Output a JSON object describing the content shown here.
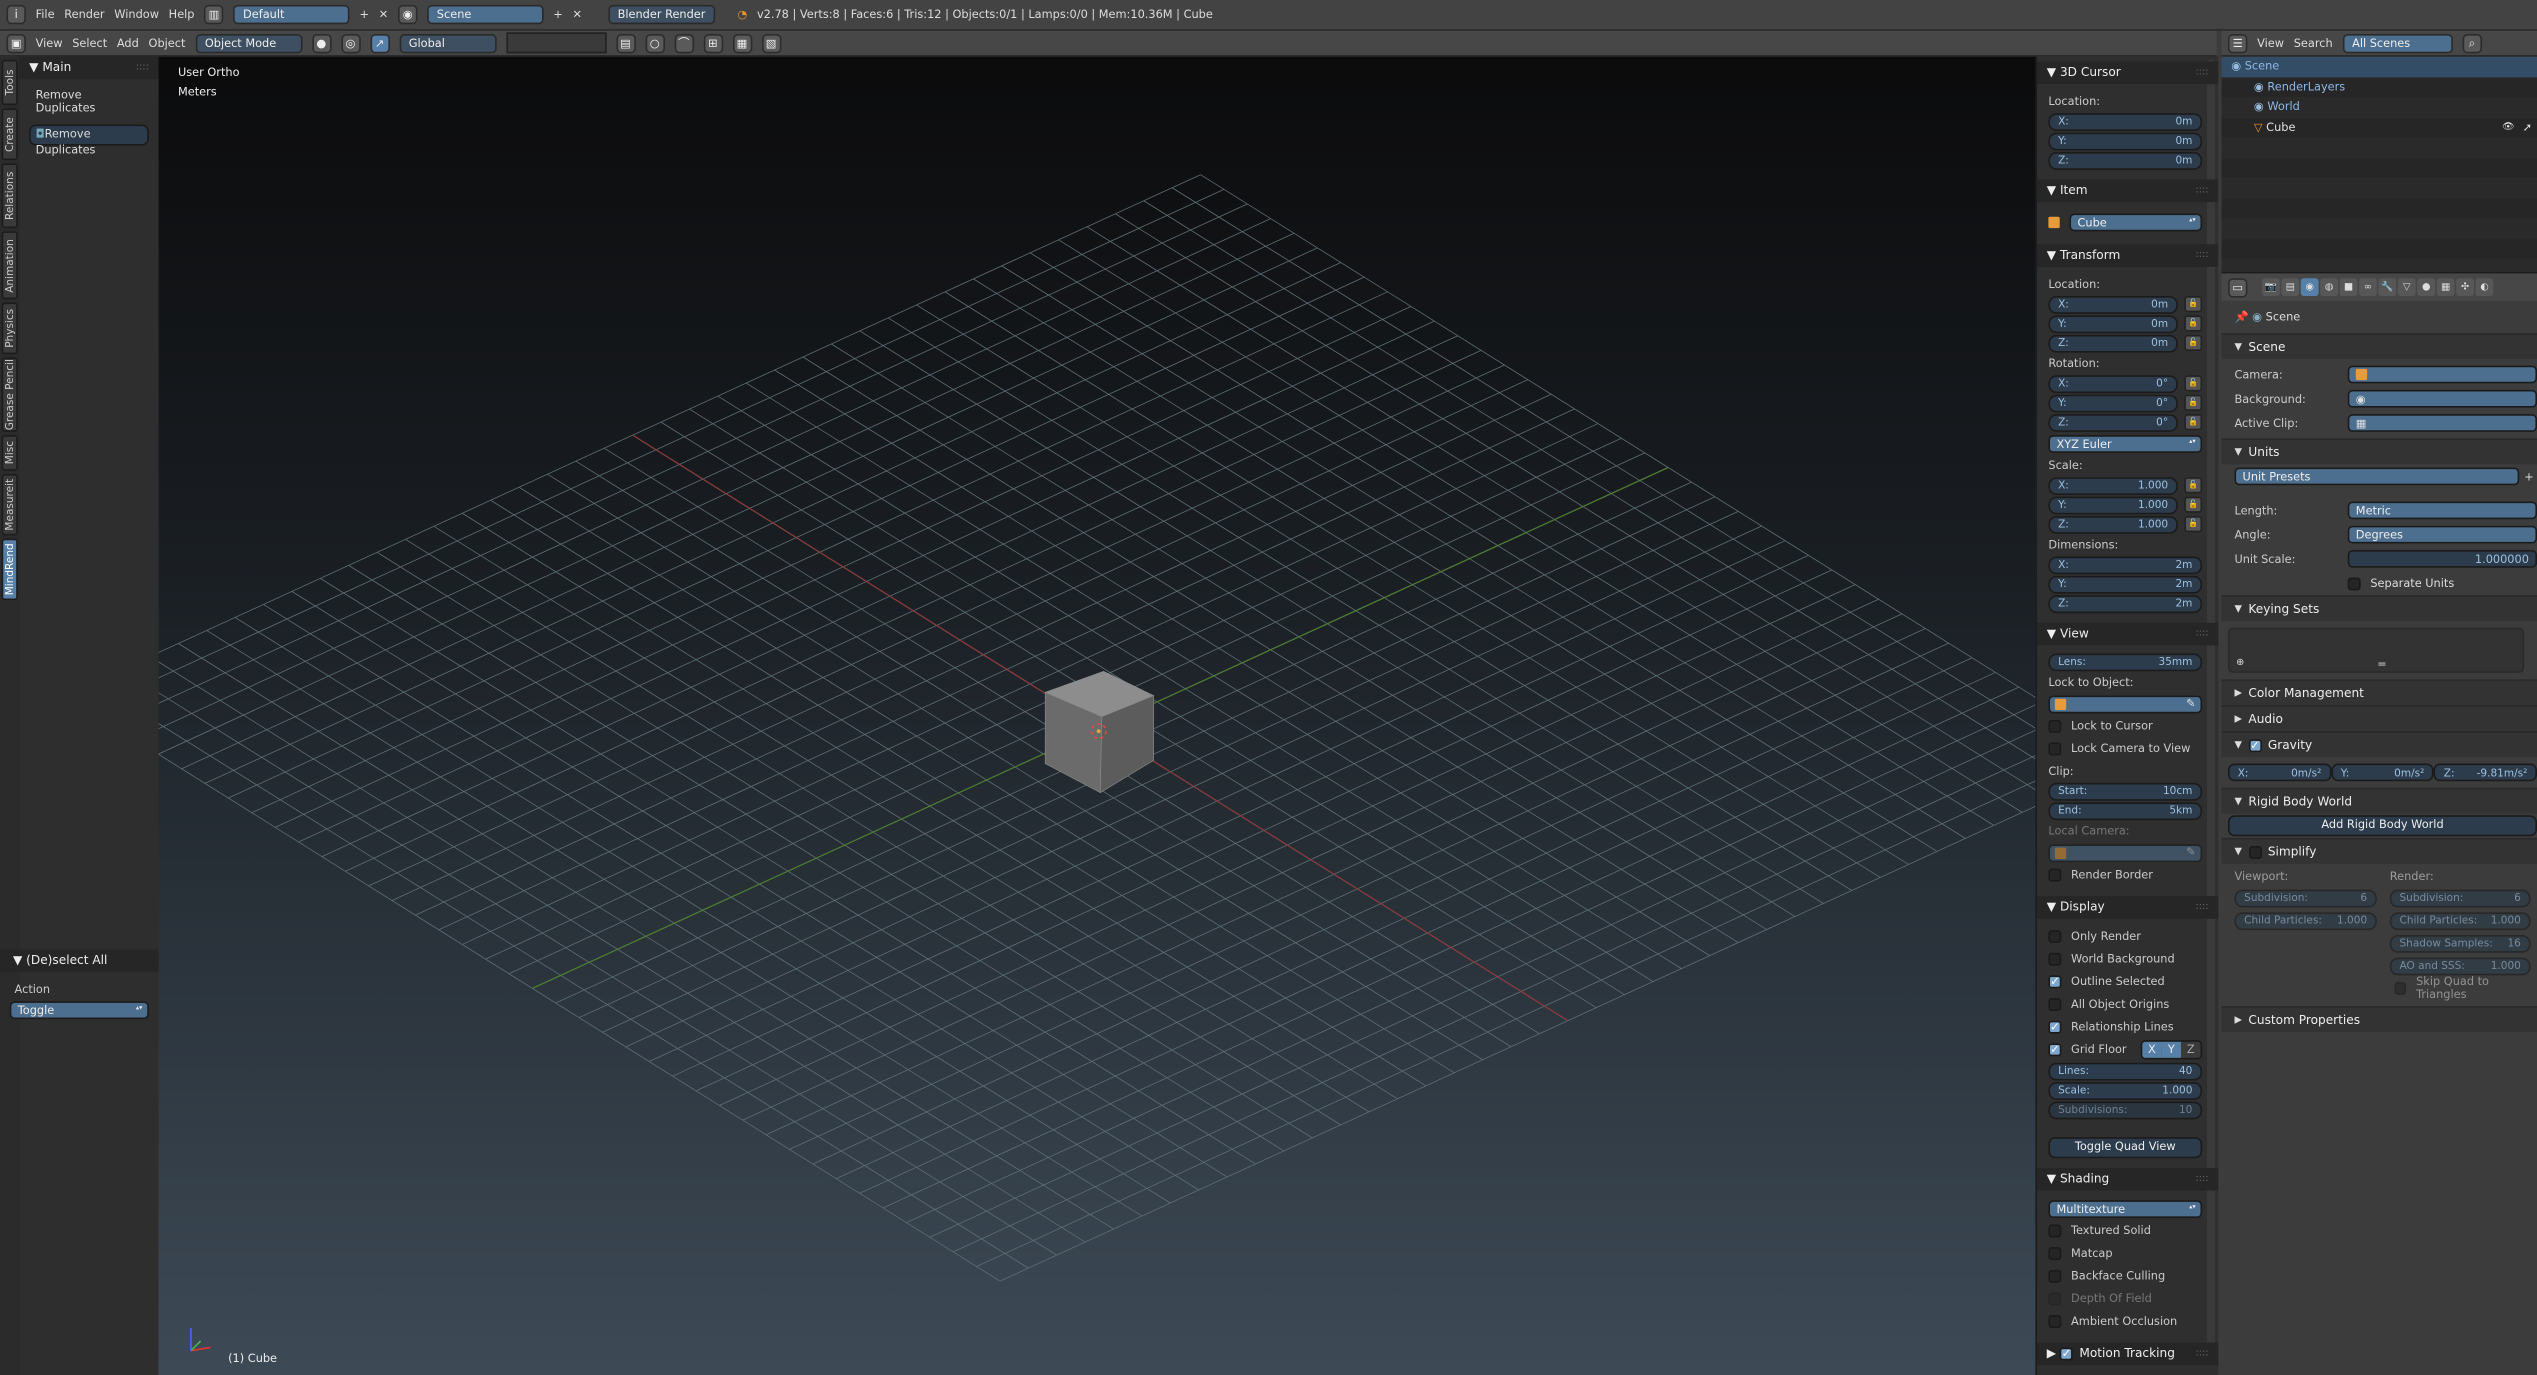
{
  "info_header": {
    "menu": [
      "File",
      "Render",
      "Window",
      "Help"
    ],
    "layout": "Default",
    "scene": "Scene",
    "engine": "Blender Render",
    "stats": "v2.78 | Verts:8 | Faces:6 | Tris:12 | Objects:0/1 | Lamps:0/0 | Mem:10.36M | Cube"
  },
  "view3d_header": {
    "menu": [
      "View",
      "Select",
      "Add",
      "Object"
    ],
    "mode": "Object Mode",
    "orientation": "Global"
  },
  "tool_tabs": [
    {
      "label": "Tools",
      "active": false
    },
    {
      "label": "Create",
      "active": false
    },
    {
      "label": "Relations",
      "active": false
    },
    {
      "label": "Animation",
      "active": false
    },
    {
      "label": "Physics",
      "active": false
    },
    {
      "label": "Grease Pencil",
      "active": false
    },
    {
      "label": "Misc",
      "active": false
    },
    {
      "label": "Measureit",
      "active": false
    },
    {
      "label": "MindRend",
      "active": true
    }
  ],
  "tool_panel": {
    "main_title": "Main",
    "main_label": "Remove Duplicates",
    "main_button": "Remove Duplicates",
    "operator_title": "(De)select All",
    "action_label": "Action",
    "action_value": "Toggle"
  },
  "viewport": {
    "view_name": "User Ortho",
    "units": "Meters",
    "object_label": "(1) Cube",
    "grid_color": "#5e6e74",
    "x_axis_color": "#8a3b3b",
    "y_axis_color": "#4e7a32"
  },
  "n_panel": {
    "sections": [
      {
        "title": "3D Cursor",
        "open": true,
        "rows": [
          {
            "t": "label",
            "text": "Location:"
          },
          {
            "t": "num",
            "label": "X:",
            "value": "0m"
          },
          {
            "t": "num",
            "label": "Y:",
            "value": "0m"
          },
          {
            "t": "num",
            "label": "Z:",
            "value": "0m"
          }
        ]
      },
      {
        "title": "Item",
        "open": true,
        "rows": [
          {
            "t": "name",
            "value": "Cube"
          }
        ]
      },
      {
        "title": "Transform",
        "open": true,
        "rows": [
          {
            "t": "label",
            "text": "Location:"
          },
          {
            "t": "num",
            "label": "X:",
            "value": "0m",
            "lock": true
          },
          {
            "t": "num",
            "label": "Y:",
            "value": "0m",
            "lock": true
          },
          {
            "t": "num",
            "label": "Z:",
            "value": "0m",
            "lock": true
          },
          {
            "t": "label",
            "text": "Rotation:"
          },
          {
            "t": "num",
            "label": "X:",
            "value": "0°",
            "lock": true
          },
          {
            "t": "num",
            "label": "Y:",
            "value": "0°",
            "lock": true
          },
          {
            "t": "num",
            "label": "Z:",
            "value": "0°",
            "lock": true
          },
          {
            "t": "select",
            "value": "XYZ Euler"
          },
          {
            "t": "label",
            "text": "Scale:"
          },
          {
            "t": "num",
            "label": "X:",
            "value": "1.000",
            "lock": true
          },
          {
            "t": "num",
            "label": "Y:",
            "value": "1.000",
            "lock": true
          },
          {
            "t": "num",
            "label": "Z:",
            "value": "1.000",
            "lock": true
          },
          {
            "t": "label",
            "text": "Dimensions:"
          },
          {
            "t": "num",
            "label": "X:",
            "value": "2m"
          },
          {
            "t": "num",
            "label": "Y:",
            "value": "2m"
          },
          {
            "t": "num",
            "label": "Z:",
            "value": "2m"
          }
        ]
      },
      {
        "title": "View",
        "open": true,
        "rows": [
          {
            "t": "num",
            "label": "Lens:",
            "value": "35mm"
          },
          {
            "t": "label",
            "text": "Lock to Object:"
          },
          {
            "t": "obj"
          },
          {
            "t": "check",
            "label": "Lock to Cursor",
            "checked": false
          },
          {
            "t": "check",
            "label": "Lock Camera to View",
            "checked": false
          },
          {
            "t": "label",
            "text": "Clip:"
          },
          {
            "t": "num",
            "label": "Start:",
            "value": "10cm"
          },
          {
            "t": "num",
            "label": "End:",
            "value": "5km"
          },
          {
            "t": "label",
            "text": "Local Camera:",
            "disabled": true
          },
          {
            "t": "obj",
            "disabled": true
          },
          {
            "t": "check",
            "label": "Render Border",
            "checked": false
          }
        ]
      },
      {
        "title": "Display",
        "open": true,
        "rows": [
          {
            "t": "check",
            "label": "Only Render",
            "checked": false
          },
          {
            "t": "check",
            "label": "World Background",
            "checked": false
          },
          {
            "t": "check",
            "label": "Outline Selected",
            "checked": true
          },
          {
            "t": "check",
            "label": "All Object Origins",
            "checked": false
          },
          {
            "t": "check",
            "label": "Relationship Lines",
            "checked": true
          },
          {
            "t": "checkaxes",
            "label": "Grid Floor",
            "checked": true,
            "axes": [
              {
                "l": "X",
                "on": true
              },
              {
                "l": "Y",
                "on": true
              },
              {
                "l": "Z",
                "on": false
              }
            ]
          },
          {
            "t": "num",
            "label": "Lines:",
            "value": "40"
          },
          {
            "t": "num",
            "label": "Scale:",
            "value": "1.000"
          },
          {
            "t": "num",
            "label": "Subdivisions:",
            "value": "10",
            "disabled": true
          },
          {
            "t": "space"
          },
          {
            "t": "button",
            "label": "Toggle Quad View"
          }
        ]
      },
      {
        "title": "Shading",
        "open": true,
        "rows": [
          {
            "t": "select",
            "value": "Multitexture"
          },
          {
            "t": "check",
            "label": "Textured Solid",
            "checked": false
          },
          {
            "t": "check",
            "label": "Matcap",
            "checked": false
          },
          {
            "t": "check",
            "label": "Backface Culling",
            "checked": false
          },
          {
            "t": "check",
            "label": "Depth Of Field",
            "checked": false,
            "disabled": true
          },
          {
            "t": "check",
            "label": "Ambient Occlusion",
            "checked": false
          }
        ]
      },
      {
        "title": "Motion Tracking",
        "open": false,
        "check": true,
        "rows": []
      }
    ]
  },
  "outliner": {
    "menu": [
      "View",
      "Search"
    ],
    "filter": "All Scenes",
    "items": [
      {
        "label": "Scene",
        "depth": 0,
        "selected": true
      },
      {
        "label": "RenderLayers",
        "depth": 1
      },
      {
        "label": "World",
        "depth": 1
      },
      {
        "label": "Cube",
        "depth": 1,
        "color": "#e0e0e0"
      }
    ]
  },
  "properties": {
    "tabs": [
      "render",
      "render-layers",
      "scene",
      "world",
      "object",
      "constraints",
      "modifiers",
      "data",
      "material",
      "texture",
      "particles",
      "physics"
    ],
    "active_tab": "scene",
    "breadcrumb": "Scene",
    "scene_section": "Scene",
    "camera_label": "Camera:",
    "background_label": "Background:",
    "active_clip_label": "Active Clip:",
    "units_section": "Units",
    "unit_presets": "Unit Presets",
    "length_label": "Length:",
    "length_value": "Metric",
    "angle_label": "Angle:",
    "angle_value": "Degrees",
    "unit_scale_label": "Unit Scale:",
    "unit_scale_value": "1.000000",
    "separate_units": "Separate Units",
    "keying_sets": "Keying Sets",
    "color_management": "Color Management",
    "audio": "Audio",
    "gravity": "Gravity",
    "gravity_values": [
      {
        "label": "X:",
        "value": "0m/s²"
      },
      {
        "label": "Y:",
        "value": "0m/s²"
      },
      {
        "label": "Z:",
        "value": "-9.81m/s²"
      }
    ],
    "rigid_body_world": "Rigid Body World",
    "add_rigid_body_world": "Add Rigid Body World",
    "simplify": "Simplify",
    "viewport_label": "Viewport:",
    "render_label": "Render:",
    "viewport_fields": [
      {
        "label": "Subdivision:",
        "value": "6"
      },
      {
        "label": "Child Particles:",
        "value": "1.000"
      }
    ],
    "render_fields": [
      {
        "label": "Subdivision:",
        "value": "6"
      },
      {
        "label": "Child Particles:",
        "value": "1.000"
      },
      {
        "label": "Shadow Samples:",
        "value": "16"
      },
      {
        "label": "AO and SSS:",
        "value": "1.000"
      }
    ],
    "skip_quad": "Skip Quad to Triangles",
    "custom_properties": "Custom Properties"
  }
}
